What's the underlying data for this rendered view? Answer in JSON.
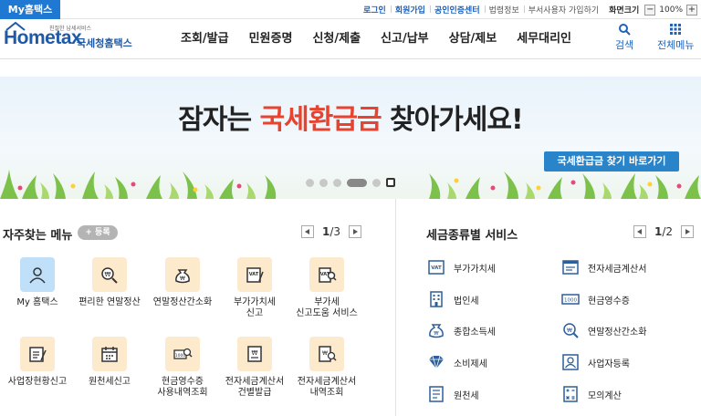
{
  "topbar": {
    "my_tab": "My홈택스",
    "links": [
      "로그인",
      "회원가입",
      "공인인증센터",
      "법령정보",
      "부서사용자 가입하기"
    ],
    "zoom_label": "화면크기",
    "zoom_value": "100%",
    "zoom_minus": "−",
    "zoom_plus": "+"
  },
  "header": {
    "logo_text": "Hometax",
    "logo_tag": "친절한 납세서비스",
    "logo_sub": "국세청홈택스",
    "nav": [
      "조회/발급",
      "민원증명",
      "신청/제출",
      "신고/납부",
      "상담/제보",
      "세무대리인"
    ],
    "search_label": "검색",
    "menu_label": "전체메뉴"
  },
  "banner": {
    "title_pre": "잠자는 ",
    "title_hl": "국세환급금",
    "title_post": " 찾아가세요!",
    "button": "국세환급금 찾기 바로가기",
    "slide_index": 6,
    "slide_count": 6
  },
  "favorites": {
    "title": "자주찾는 메뉴",
    "register": "+ 등록",
    "page_current": "1",
    "page_total": "/3",
    "items": [
      {
        "label1": "My 홈택스",
        "label2": "",
        "icon": "user-icon"
      },
      {
        "label1": "편리한 연말정산",
        "label2": "",
        "icon": "money-search-icon"
      },
      {
        "label1": "연말정산간소화",
        "label2": "",
        "icon": "money-bag-icon"
      },
      {
        "label1": "부가가치세",
        "label2": "신고",
        "icon": "vat-form-icon"
      },
      {
        "label1": "부가세",
        "label2": "신고도움 서비스",
        "icon": "vat-help-icon"
      },
      {
        "label1": "사업장현황신고",
        "label2": "",
        "icon": "report-pen-icon"
      },
      {
        "label1": "원천세신고",
        "label2": "",
        "icon": "calendar-icon"
      },
      {
        "label1": "현금영수증",
        "label2": "사용내역조회",
        "icon": "receipt-search-icon"
      },
      {
        "label1": "전자세금계산서",
        "label2": "건별발급",
        "icon": "invoice-icon"
      },
      {
        "label1": "전자세금계산서",
        "label2": "내역조회",
        "icon": "invoice-search-icon"
      }
    ]
  },
  "services": {
    "title": "세금종류별 서비스",
    "page_current": "1",
    "page_total": "/2",
    "items": [
      {
        "label": "부가가치세",
        "icon": "vat-icon"
      },
      {
        "label": "전자세금계산서",
        "icon": "e-invoice-icon"
      },
      {
        "label": "법인세",
        "icon": "building-icon"
      },
      {
        "label": "현금영수증",
        "icon": "cash-receipt-icon"
      },
      {
        "label": "종합소득세",
        "icon": "income-tax-icon"
      },
      {
        "label": "연말정산간소화",
        "icon": "year-end-icon"
      },
      {
        "label": "소비제세",
        "icon": "diamond-icon"
      },
      {
        "label": "사업자등록",
        "icon": "business-registration-icon"
      },
      {
        "label": "원천세",
        "icon": "withholding-icon"
      },
      {
        "label": "모의계산",
        "icon": "calculator-icon"
      }
    ]
  },
  "colors": {
    "brand_blue": "#1f62b8",
    "highlight_red": "#e8432e",
    "banner_button": "#2a84c9",
    "tile_orange": "#fdeacc",
    "tile_blue": "#bfe0f8"
  }
}
